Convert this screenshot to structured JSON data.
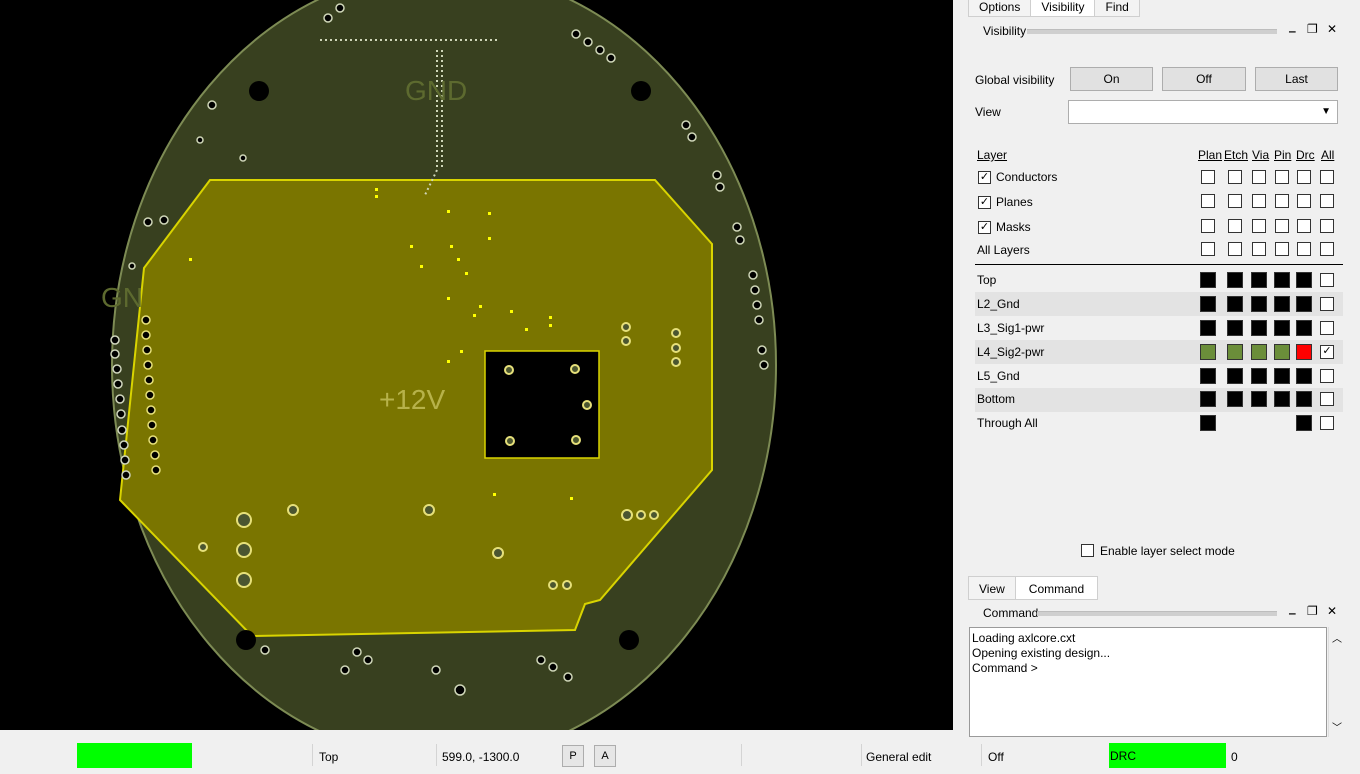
{
  "canvas": {
    "labels": {
      "gnd_top": "GND",
      "gnd_left": "GN",
      "net_12v": "+12V"
    },
    "colors": {
      "board": "#38401f",
      "plane": "#7a7500",
      "plane_edge": "#d9d400",
      "background": "#000000"
    }
  },
  "panel": {
    "tabs": [
      "Options",
      "Visibility",
      "Find"
    ],
    "title": "Visibility",
    "global_visibility_label": "Global visibility",
    "buttons": {
      "on": "On",
      "off": "Off",
      "last": "Last"
    },
    "view_label": "View",
    "view_value": "",
    "layer_header": "Layer",
    "col_headers": [
      "Plan",
      "Etch",
      "Via",
      "Pin",
      "Drc",
      "All"
    ],
    "group_rows": [
      {
        "label": "Conductors",
        "checked": true
      },
      {
        "label": "Planes",
        "checked": true
      },
      {
        "label": "Masks",
        "checked": true
      },
      {
        "label": "All Layers"
      }
    ],
    "layer_rows": [
      {
        "label": "Top",
        "fill": "#000000",
        "all": false
      },
      {
        "label": "L2_Gnd",
        "fill": "#000000",
        "all": false
      },
      {
        "label": "L3_Sig1-pwr",
        "fill": "#000000",
        "all": false
      },
      {
        "label": "L4_Sig2-pwr",
        "fill": "#6b8e3a",
        "drc": "#ff0000",
        "all": true
      },
      {
        "label": "L5_Gnd",
        "fill": "#000000",
        "all": false
      },
      {
        "label": "Bottom",
        "fill": "#000000",
        "all": false
      },
      {
        "label": "Through All",
        "fill": "#000000",
        "all": false
      }
    ],
    "enable_layer_select": "Enable layer select mode",
    "bottom_tabs": [
      "View",
      "Command"
    ],
    "command_title": "Command",
    "command_lines": [
      "Loading axlcore.cxt",
      "Opening existing design...",
      "Command >"
    ]
  },
  "status": {
    "indicator_color": "#00ff00",
    "layer": "Top",
    "coordinates": "599.0, -1300.0",
    "p_button": "P",
    "a_button": "A",
    "mode": "General edit",
    "off": "Off",
    "drc_label": "DRC",
    "drc_color": "#00ff00",
    "drc_count": "0"
  }
}
